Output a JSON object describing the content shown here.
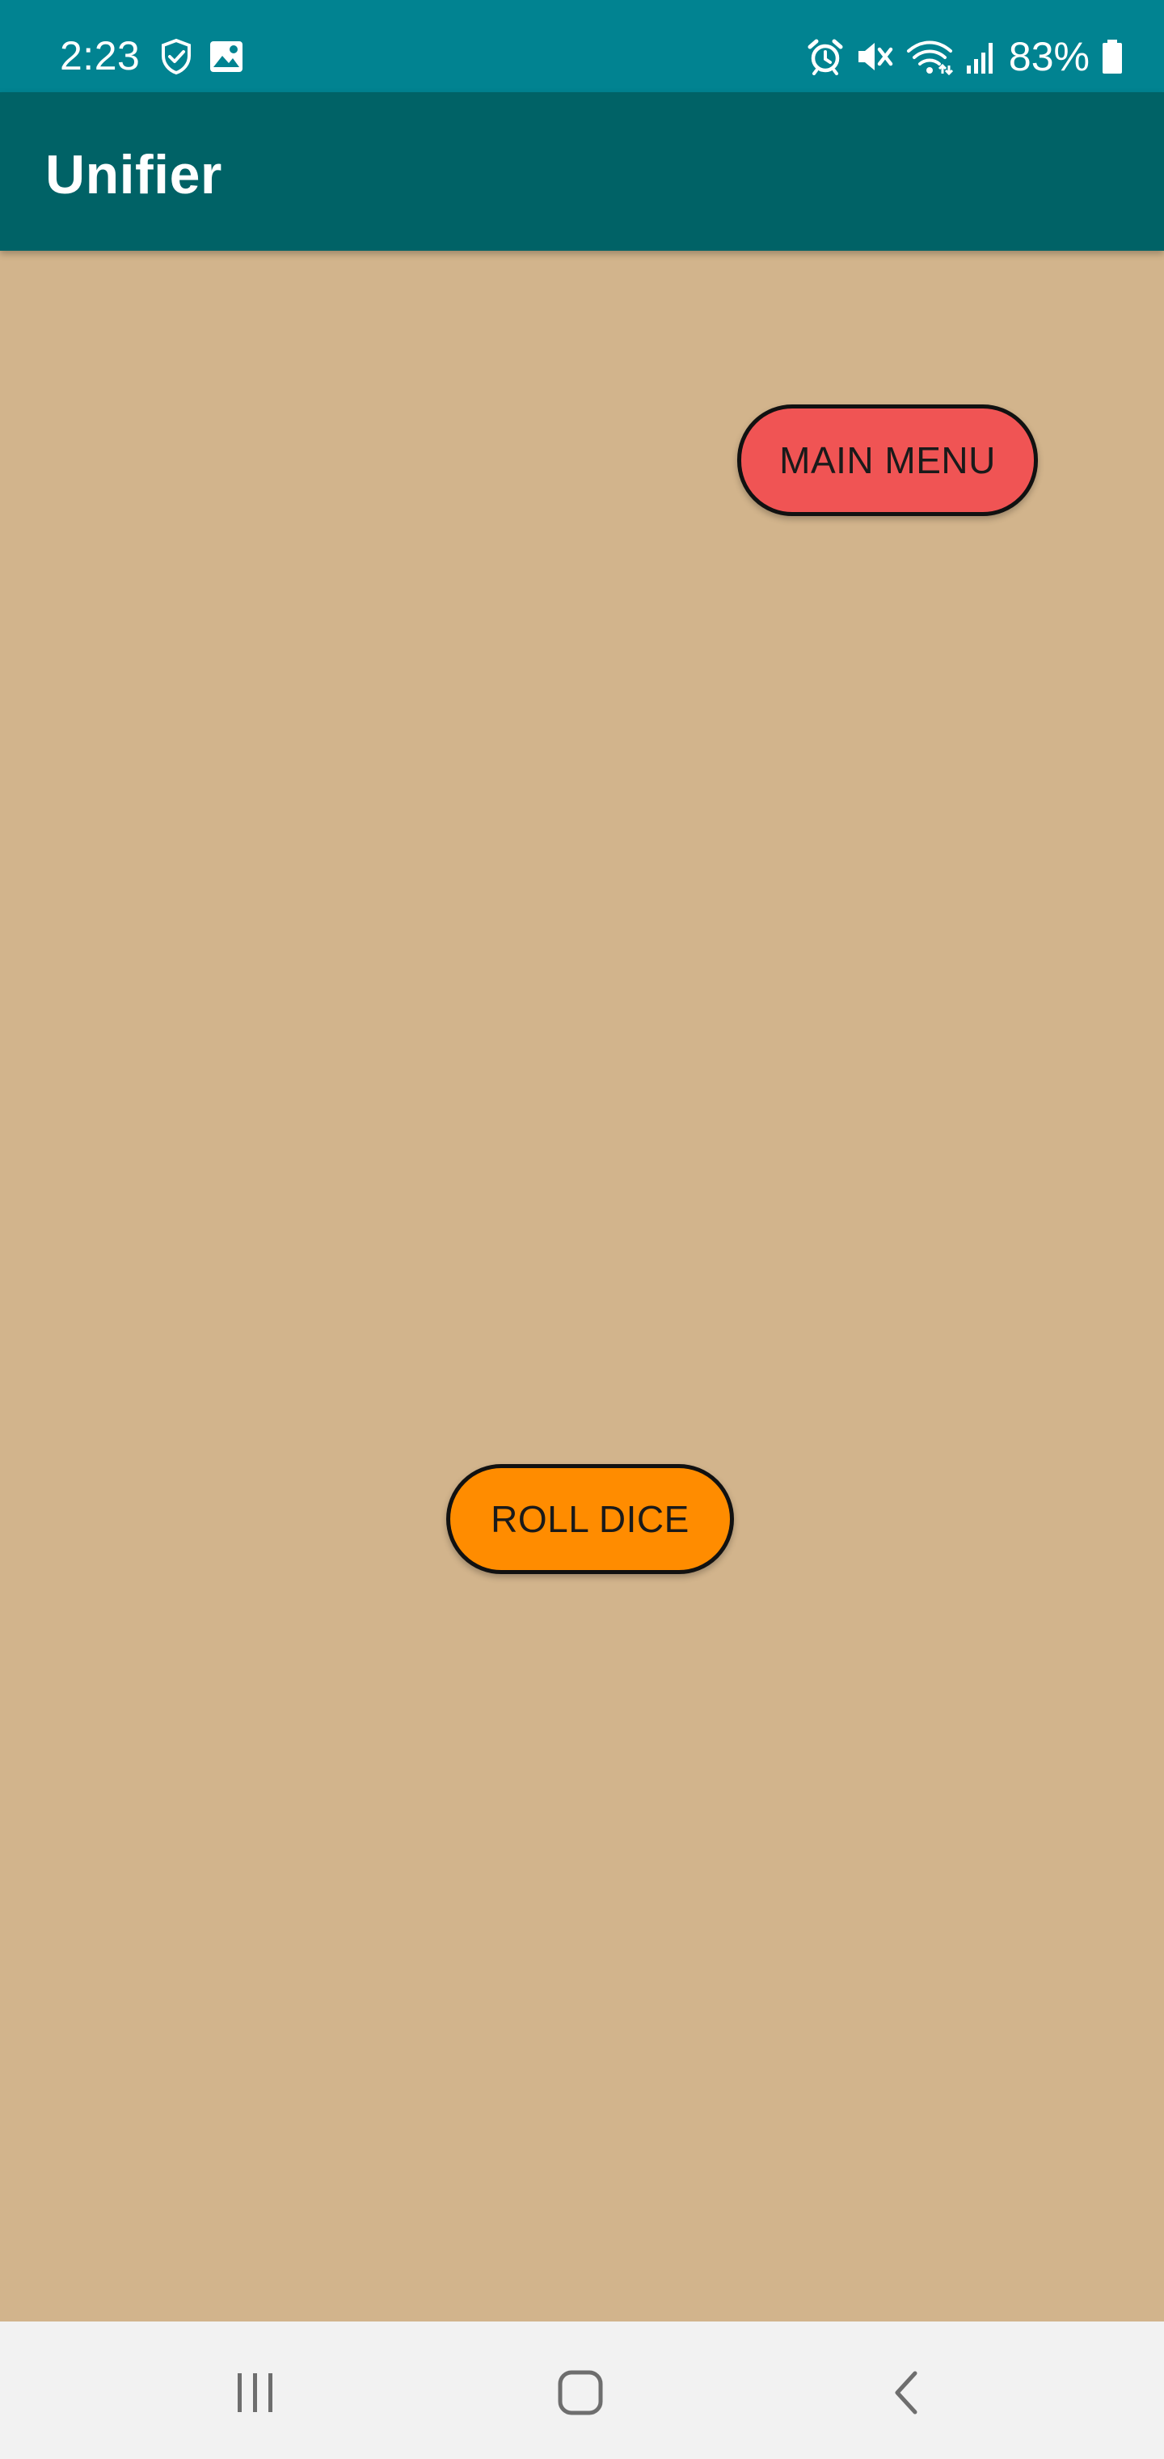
{
  "status_bar": {
    "time": "2:23",
    "battery_percent": "83%",
    "icons": [
      "shield-check-icon",
      "image-icon",
      "alarm-icon",
      "mute-icon",
      "wifi-icon",
      "signal-icon",
      "battery-icon"
    ],
    "background": "#018391"
  },
  "app_bar": {
    "title": "Unifier",
    "background": "#006266"
  },
  "content": {
    "background": "#d2b48c",
    "main_menu_label": "MAIN MENU",
    "main_menu_color": "#f05454",
    "roll_dice_label": "ROLL DICE",
    "roll_dice_color": "#ff8c00"
  },
  "nav_bar": {
    "icons": [
      "recents-icon",
      "home-icon",
      "back-icon"
    ]
  }
}
